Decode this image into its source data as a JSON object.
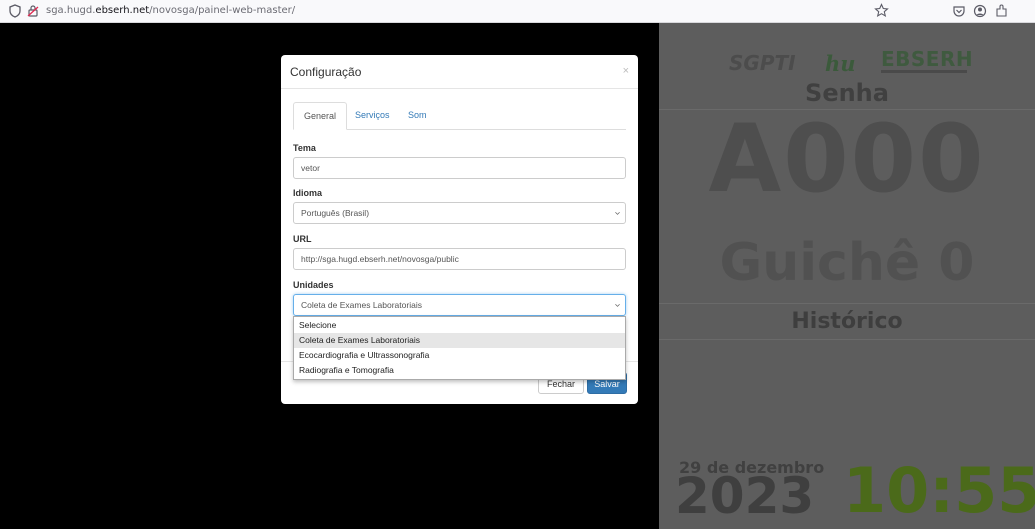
{
  "browser": {
    "url_prefix": "sga.hugd.",
    "url_domain": "ebserh.net",
    "url_path": "/novosga/painel-web-master/"
  },
  "panel": {
    "logo_sgpti": "SGPTI",
    "logo_hu": "hu",
    "logo_ebserh": "EBSERH",
    "senha_label": "Senha",
    "ticket": "A000",
    "guiche": "Guichê 0",
    "historico_label": "Histórico",
    "date": "29 de dezembro",
    "year": "2023",
    "time": "10:55"
  },
  "modal": {
    "title": "Configuração",
    "close": "×",
    "tabs": [
      {
        "label": "General",
        "active": true
      },
      {
        "label": "Serviços",
        "active": false
      },
      {
        "label": "Som",
        "active": false
      }
    ],
    "tema": {
      "label": "Tema",
      "value": "vetor"
    },
    "idioma": {
      "label": "Idioma",
      "value": "Português (Brasil)"
    },
    "url": {
      "label": "URL",
      "value": "http://sga.hugd.ebserh.net/novosga/public"
    },
    "unidades": {
      "label": "Unidades",
      "value": "Coleta de Exames Laboratoriais",
      "options": [
        "Selecione",
        "Coleta de Exames Laboratoriais",
        "Ecocardiografia e Ultrassonografia",
        "Radiografia e Tomografia"
      ]
    },
    "buttons": {
      "close": "Fechar",
      "save": "Salvar"
    }
  }
}
